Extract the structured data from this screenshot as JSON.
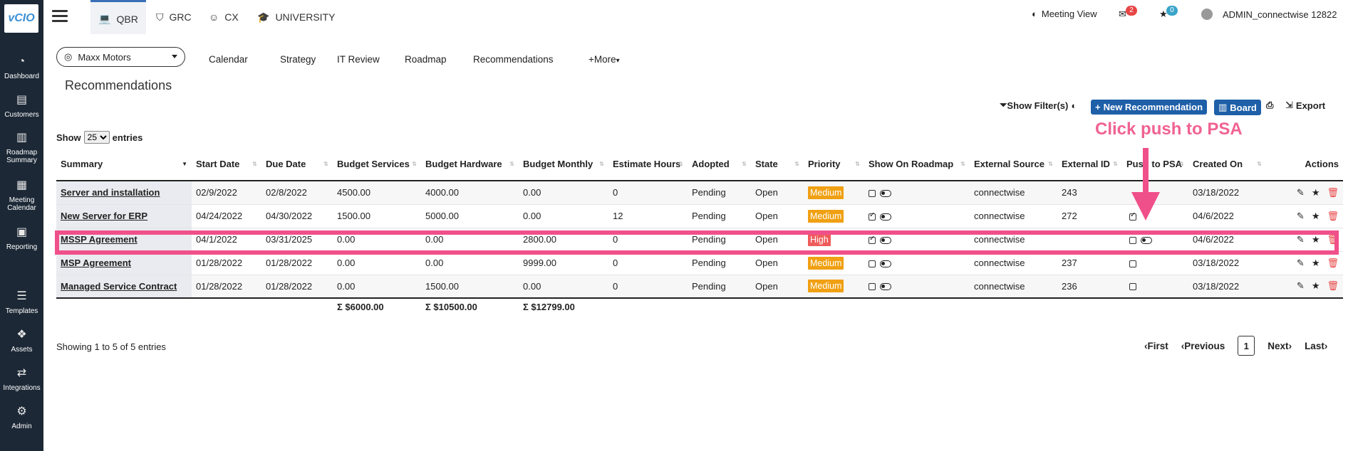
{
  "sidebar": {
    "logo": "vCIO",
    "items": [
      {
        "label": "Dashboard",
        "icon": "gauge-icon"
      },
      {
        "label": "Customers",
        "icon": "id-card-icon"
      },
      {
        "label": "Roadmap Summary",
        "icon": "map-icon"
      },
      {
        "label": "Meeting Calendar",
        "icon": "calendar-icon"
      },
      {
        "label": "Reporting",
        "icon": "report-icon"
      },
      {
        "label": "Templates",
        "icon": "templates-icon"
      },
      {
        "label": "Assets",
        "icon": "cubes-icon"
      },
      {
        "label": "Integrations",
        "icon": "shuffle-icon"
      },
      {
        "label": "Admin",
        "icon": "gears-icon"
      }
    ]
  },
  "topbar": {
    "tabs": [
      {
        "label": "QBR",
        "icon": "laptop-icon",
        "active": true
      },
      {
        "label": "GRC",
        "icon": "shield-icon"
      },
      {
        "label": "CX",
        "icon": "smile-icon"
      },
      {
        "label": "UNIVERSITY",
        "icon": "graduation-cap-icon"
      }
    ],
    "meeting_view": "Meeting View",
    "mail_count": "2",
    "star_count": "0",
    "user": "ADMIN_connectwise 12822"
  },
  "client": {
    "selected": "Maxx Motors"
  },
  "subnav": [
    "Calendar",
    "Strategy",
    "IT Review",
    "Roadmap",
    "Recommendations",
    "+More"
  ],
  "page_title": "Recommendations",
  "toolbar": {
    "show_filters": "Show Filter(s)",
    "new_recommendation": "New Recommendation",
    "board": "Board",
    "export": "Export"
  },
  "entries": {
    "show": "Show",
    "value": "25",
    "suffix": "entries"
  },
  "table": {
    "headers": [
      "Summary",
      "Start Date",
      "Due Date",
      "Budget Services",
      "Budget Hardware",
      "Budget Monthly",
      "Estimate Hours",
      "Adopted",
      "State",
      "Priority",
      "Show On Roadmap",
      "External Source",
      "External ID",
      "Push to PSA",
      "Created On",
      "Actions"
    ],
    "rows": [
      {
        "summary": "Server and installation",
        "start": "02/9/2022",
        "due": "02/8/2022",
        "services": "4500.00",
        "hardware": "4000.00",
        "monthly": "0.00",
        "hours": "0",
        "adopted": "Pending",
        "state": "Open",
        "priority": "Medium",
        "roadmap": false,
        "source": "connectwise",
        "ext_id": "243",
        "psa": "none",
        "created": "03/18/2022"
      },
      {
        "summary": "New Server for ERP",
        "start": "04/24/2022",
        "due": "04/30/2022",
        "services": "1500.00",
        "hardware": "5000.00",
        "monthly": "0.00",
        "hours": "12",
        "adopted": "Pending",
        "state": "Open",
        "priority": "Medium",
        "roadmap": true,
        "source": "connectwise",
        "ext_id": "272",
        "psa": "checked",
        "created": "04/6/2022"
      },
      {
        "summary": "MSSP Agreement",
        "start": "04/1/2022",
        "due": "03/31/2025",
        "services": "0.00",
        "hardware": "0.00",
        "monthly": "2800.00",
        "hours": "0",
        "adopted": "Pending",
        "state": "Open",
        "priority": "High",
        "roadmap": true,
        "source": "connectwise",
        "ext_id": "",
        "psa": "unchecked-toggle",
        "created": "04/6/2022"
      },
      {
        "summary": "MSP Agreement",
        "start": "01/28/2022",
        "due": "01/28/2022",
        "services": "0.00",
        "hardware": "0.00",
        "monthly": "9999.00",
        "hours": "0",
        "adopted": "Pending",
        "state": "Open",
        "priority": "Medium",
        "roadmap": false,
        "source": "connectwise",
        "ext_id": "237",
        "psa": "unchecked",
        "created": "03/18/2022"
      },
      {
        "summary": "Managed Service Contract",
        "start": "01/28/2022",
        "due": "01/28/2022",
        "services": "0.00",
        "hardware": "1500.00",
        "monthly": "0.00",
        "hours": "0",
        "adopted": "Pending",
        "state": "Open",
        "priority": "Medium",
        "roadmap": false,
        "source": "connectwise",
        "ext_id": "236",
        "psa": "unchecked",
        "created": "03/18/2022"
      }
    ],
    "totals": {
      "services": "Σ $6000.00",
      "hardware": "Σ $10500.00",
      "monthly": "Σ $12799.00"
    }
  },
  "footer": {
    "showing": "Showing 1 to 5 of 5 entries",
    "first": "First",
    "previous": "Previous",
    "page": "1",
    "next": "Next",
    "last": "Last"
  },
  "annotation": {
    "text": "Click push to PSA"
  },
  "colors": {
    "sidebar": "#1c2836",
    "accent": "#1e5fa8",
    "medium": "#f0a012",
    "high": "#ef5b5b",
    "annotation": "#f0508a"
  }
}
